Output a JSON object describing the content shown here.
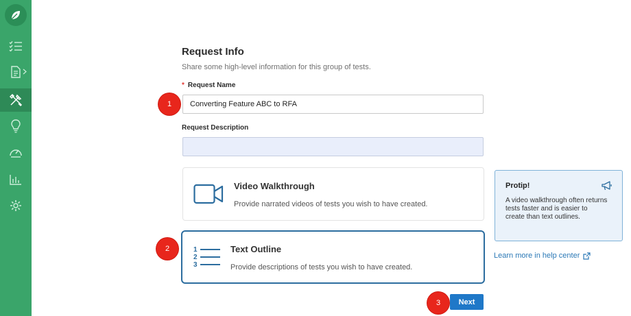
{
  "sidebar": {
    "items": [
      {
        "icon": "checklist-icon",
        "active": false
      },
      {
        "icon": "document-icon",
        "active": false
      },
      {
        "icon": "tools-icon",
        "active": true
      },
      {
        "icon": "lightbulb-icon",
        "active": false
      },
      {
        "icon": "speedometer-icon",
        "active": false
      },
      {
        "icon": "bar-chart-icon",
        "active": false
      },
      {
        "icon": "gear-icon",
        "active": false
      }
    ],
    "logo_icon": "leaf-icon"
  },
  "form": {
    "title": "Request Info",
    "subtitle": "Share some high-level information for this group of tests.",
    "required_marker": "*",
    "name_label": "Request Name",
    "name_value": "Converting Feature ABC to RFA",
    "description_label": "Request Description",
    "description_value": ""
  },
  "options": {
    "video": {
      "title": "Video Walkthrough",
      "description": "Provide narrated videos of tests you wish to have created.",
      "icon": "video-camera-icon",
      "selected": false
    },
    "text": {
      "title": "Text Outline",
      "description": "Provide descriptions of tests you wish to have created.",
      "icon": "numbered-list-icon",
      "selected": true
    }
  },
  "protip": {
    "title": "Protip!",
    "text": "A video walkthrough often returns tests faster and is easier to create than text outlines.",
    "icon": "megaphone-icon"
  },
  "help_link": {
    "label": "Learn more in help center",
    "icon": "external-link-icon"
  },
  "next_button": {
    "label": "Next"
  },
  "markers": [
    "1",
    "2",
    "3"
  ],
  "colors": {
    "sidebar": "#3aa56a",
    "sidebar_active": "#2e8a57",
    "accent": "#1f78c8",
    "selected_border": "#2c6d9f",
    "marker": "#e8261c"
  }
}
